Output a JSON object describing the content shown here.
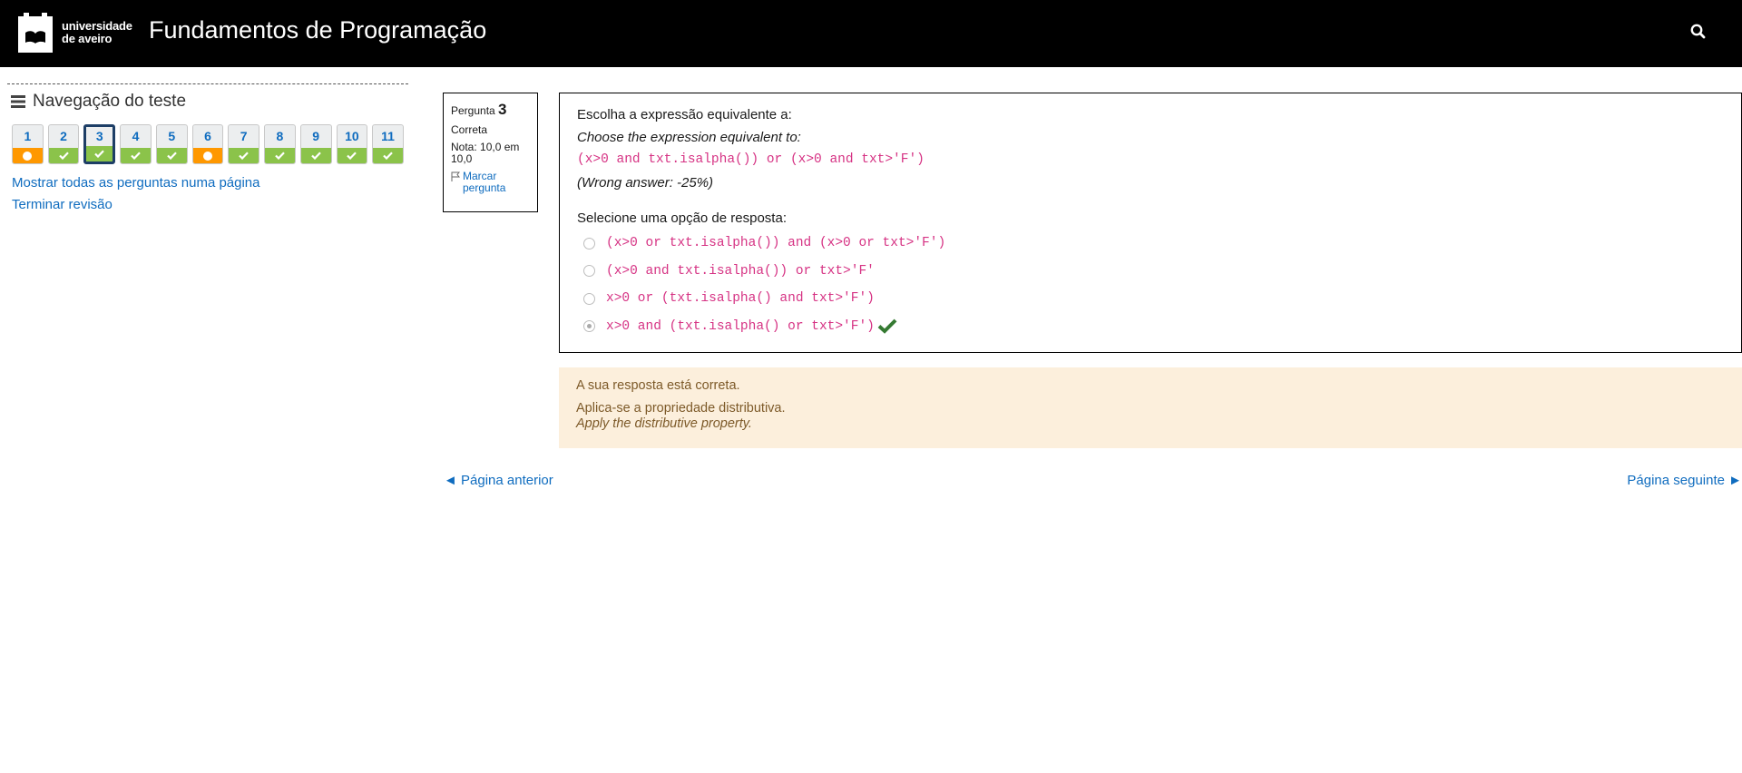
{
  "header": {
    "logo_line1": "universidade",
    "logo_line2": "de aveiro",
    "course_title": "Fundamentos de Programação",
    "search_icon": "search-icon"
  },
  "nav": {
    "title": "Navegação do teste",
    "questions": [
      {
        "num": "1",
        "state": "partial"
      },
      {
        "num": "2",
        "state": "correct"
      },
      {
        "num": "3",
        "state": "correct",
        "current": true
      },
      {
        "num": "4",
        "state": "correct"
      },
      {
        "num": "5",
        "state": "correct"
      },
      {
        "num": "6",
        "state": "partial"
      },
      {
        "num": "7",
        "state": "correct"
      },
      {
        "num": "8",
        "state": "correct"
      },
      {
        "num": "9",
        "state": "correct"
      },
      {
        "num": "10",
        "state": "correct"
      },
      {
        "num": "11",
        "state": "correct"
      }
    ],
    "show_all_link": "Mostrar todas as perguntas numa página",
    "finish_review_link": "Terminar revisão"
  },
  "info": {
    "label": "Pergunta",
    "number": "3",
    "state": "Correta",
    "grade": "Nota: 10,0 em 10,0",
    "flag_label": "Marcar pergunta"
  },
  "question": {
    "text_pt": "Escolha a expressão equivalente a:",
    "text_en": "Choose the expression equivalent to:",
    "expression": "(x>0 and txt.isalpha()) or (x>0 and txt>'F')",
    "penalty": "(Wrong answer: -25%)",
    "prompt": "Selecione uma opção de resposta:",
    "options": [
      {
        "text": "(x>0 or txt.isalpha()) and (x>0 or txt>'F')",
        "selected": false,
        "correct": false
      },
      {
        "text": "(x>0 and txt.isalpha()) or txt>'F'",
        "selected": false,
        "correct": false
      },
      {
        "text": "x>0 or (txt.isalpha() and txt>'F')",
        "selected": false,
        "correct": false
      },
      {
        "text": "x>0 and (txt.isalpha() or txt>'F')",
        "selected": true,
        "correct": true
      }
    ]
  },
  "feedback": {
    "specific": "A sua resposta está correta.",
    "general_pt": "Aplica-se a propriedade distributiva.",
    "general_en": "Apply the distributive property."
  },
  "pager": {
    "prev": "◄ Página anterior",
    "next": "Página seguinte ►"
  },
  "colors": {
    "header_bg": "#000000",
    "link": "#0f6cbf",
    "correct": "#8bc34a",
    "partial": "#ff9800",
    "code": "#d63384",
    "feedback_bg": "#fcefdc",
    "tick": "#357a32"
  }
}
